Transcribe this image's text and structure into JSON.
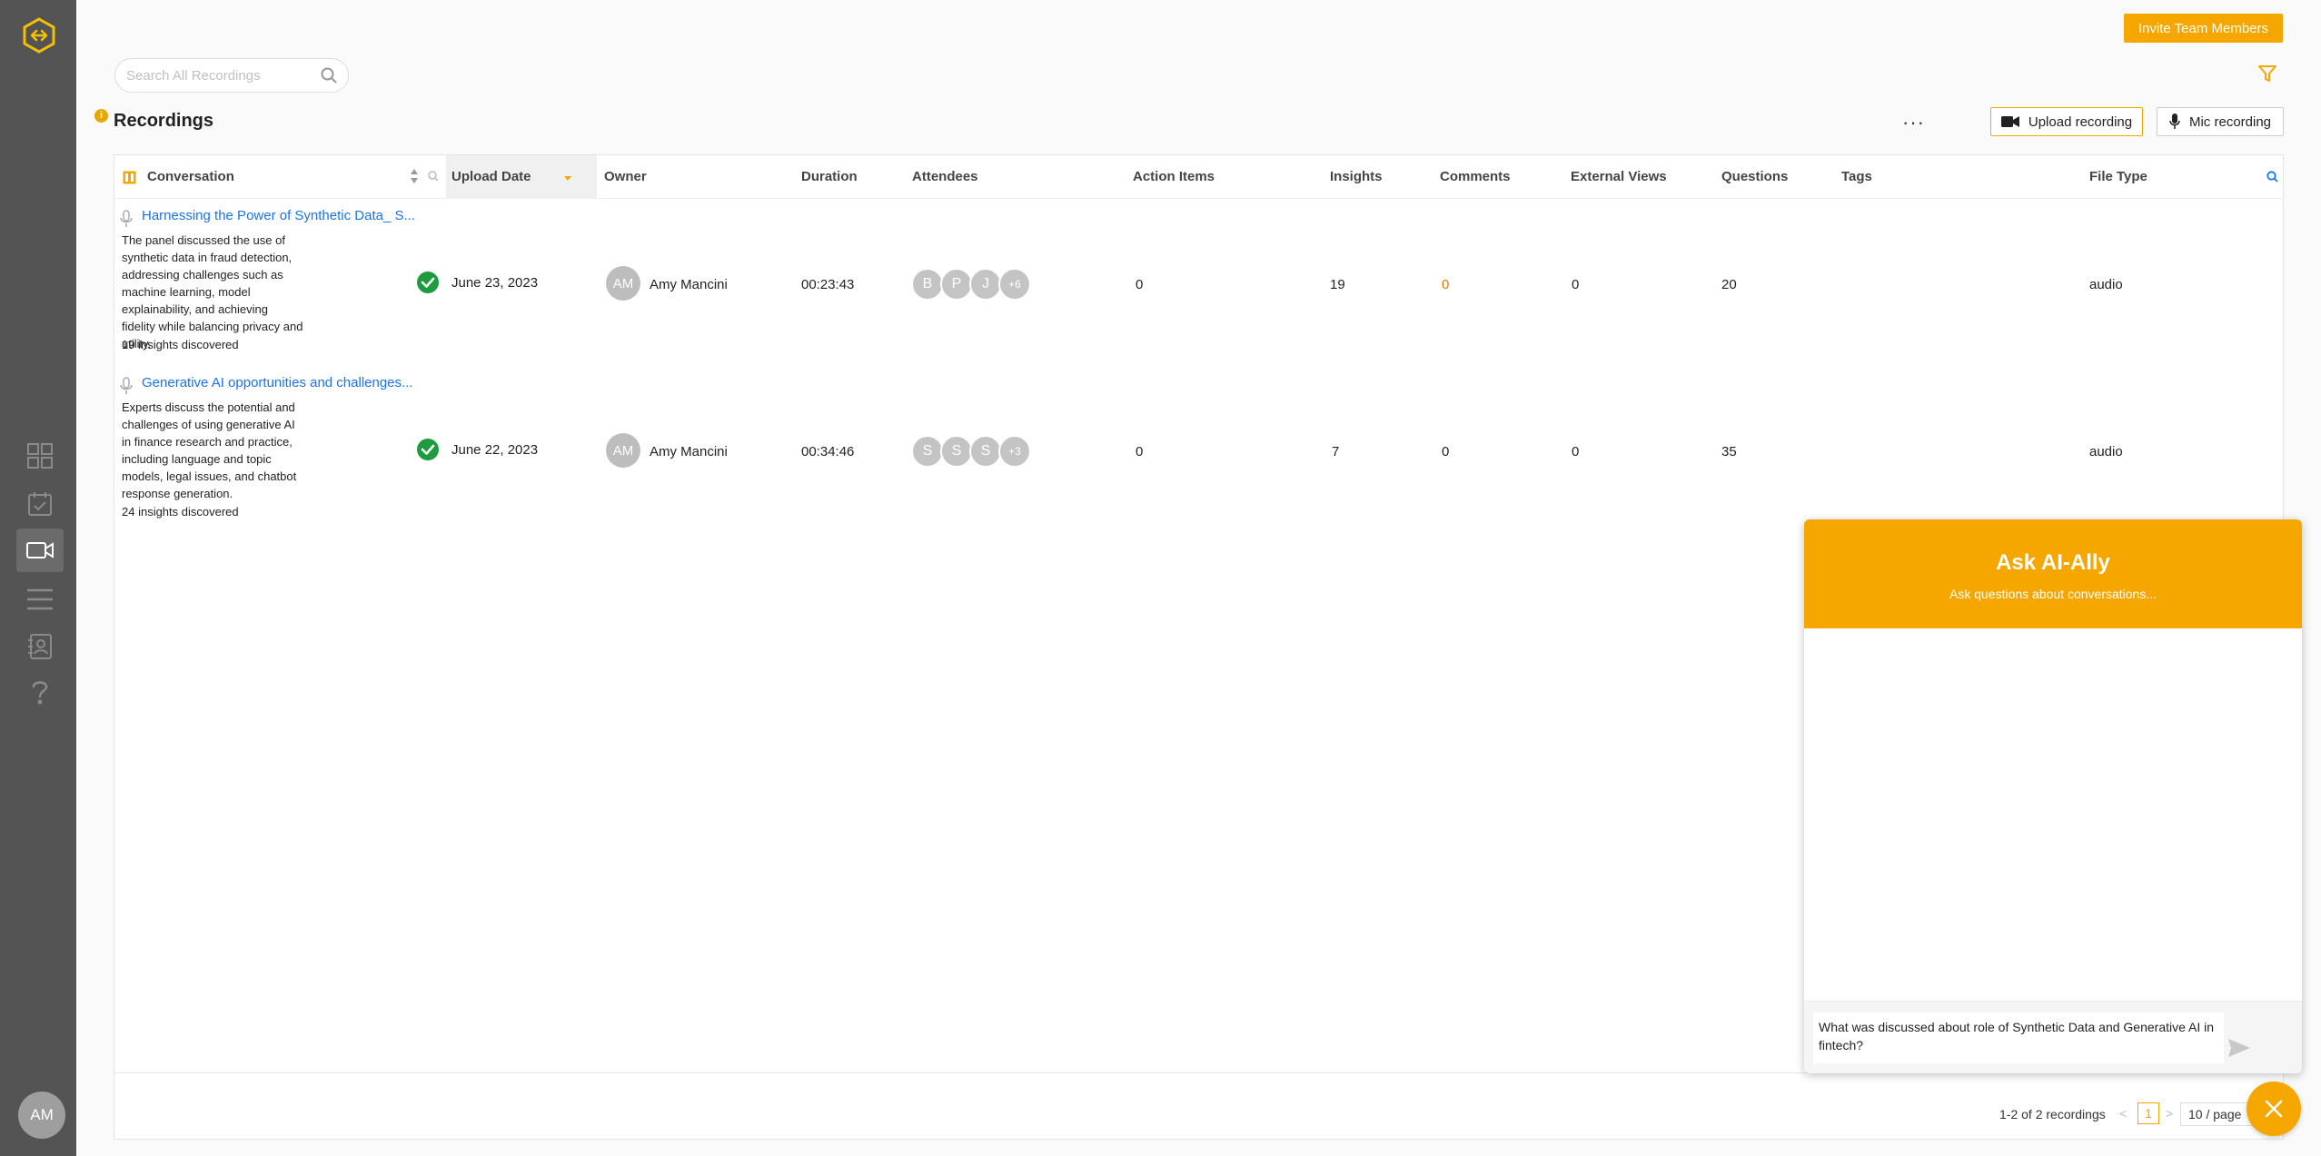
{
  "header": {
    "invite_label": "Invite Team Members",
    "search_placeholder": "Search All Recordings",
    "page_title": "Recordings",
    "more_label": "···",
    "upload_label": "Upload recording",
    "mic_label": "Mic recording"
  },
  "sidebar": {
    "avatar_initials": "AM",
    "items": [
      {
        "icon": "grid-icon"
      },
      {
        "icon": "calendar-check-icon"
      },
      {
        "icon": "video-camera-icon"
      },
      {
        "icon": "menu-lines-icon"
      },
      {
        "icon": "contact-book-icon"
      },
      {
        "icon": "help-icon"
      }
    ]
  },
  "table": {
    "columns": [
      "Conversation",
      "Upload Date",
      "Owner",
      "Duration",
      "Attendees",
      "Action Items",
      "Insights",
      "Comments",
      "External Views",
      "Questions",
      "Tags",
      "File Type"
    ],
    "rows": [
      {
        "title": "Harnessing the Power of Synthetic Data_ S...",
        "summary": "The panel discussed the use of synthetic data in fraud detection, addressing challenges such as machine learning, model explainability, and achieving fidelity while balancing privacy and utility.",
        "insights_found": "19 insights discovered",
        "date": "June 23, 2023",
        "owner_initials": "AM",
        "owner": "Amy Mancini",
        "duration": "00:23:43",
        "attendees": [
          "B",
          "P",
          "J",
          "+6"
        ],
        "action_items": "0",
        "insights": "19",
        "comments": "0",
        "external_views": "0",
        "questions": "20",
        "tags": "",
        "file_type": "audio"
      },
      {
        "title": "Generative AI opportunities and challenges...",
        "summary": "Experts discuss the potential and challenges of using generative AI in finance research and practice, including language and topic models, legal issues, and chatbot response generation.",
        "insights_found": "24 insights discovered",
        "date": "June 22, 2023",
        "owner_initials": "AM",
        "owner": "Amy Mancini",
        "duration": "00:34:46",
        "attendees": [
          "S",
          "S",
          "S",
          "+3"
        ],
        "action_items": "0",
        "insights": "7",
        "comments": "0",
        "external_views": "0",
        "questions": "35",
        "tags": "",
        "file_type": "audio"
      }
    ]
  },
  "pagination": {
    "count": "1-2 of 2 recordings",
    "prev": "<",
    "current": "1",
    "next": ">",
    "page_size": "10 / page"
  },
  "ally": {
    "title": "Ask AI-Ally",
    "subtitle": "Ask questions about conversations...",
    "input_value": "What was discussed about role of Synthetic Data and Generative AI in fintech?"
  },
  "colors": {
    "accent": "#f5a700",
    "link": "#1a73e8",
    "success": "#1e9b3e",
    "sidebar": "#545454"
  }
}
